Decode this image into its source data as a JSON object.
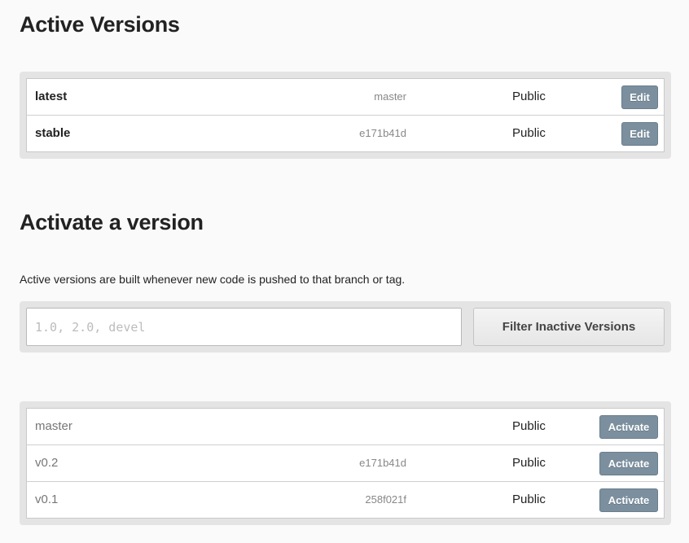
{
  "active_versions": {
    "title": "Active Versions",
    "rows": [
      {
        "name": "latest",
        "identifier": "master",
        "privacy": "Public",
        "action": "Edit"
      },
      {
        "name": "stable",
        "identifier": "e171b41d",
        "privacy": "Public",
        "action": "Edit"
      }
    ]
  },
  "activate": {
    "title": "Activate a version",
    "help_text": "Active versions are built whenever new code is pushed to that branch or tag.",
    "filter": {
      "placeholder": "1.0, 2.0, devel",
      "value": "",
      "button_label": "Filter Inactive Versions"
    },
    "rows": [
      {
        "name": "master",
        "identifier": "",
        "privacy": "Public",
        "action": "Activate"
      },
      {
        "name": "v0.2",
        "identifier": "e171b41d",
        "privacy": "Public",
        "action": "Activate"
      },
      {
        "name": "v0.1",
        "identifier": "258f021f",
        "privacy": "Public",
        "action": "Activate"
      }
    ]
  },
  "colors": {
    "button_primary": "#7b8f9e",
    "well_background": "#e4e4e4",
    "page_background": "#fafafa"
  }
}
